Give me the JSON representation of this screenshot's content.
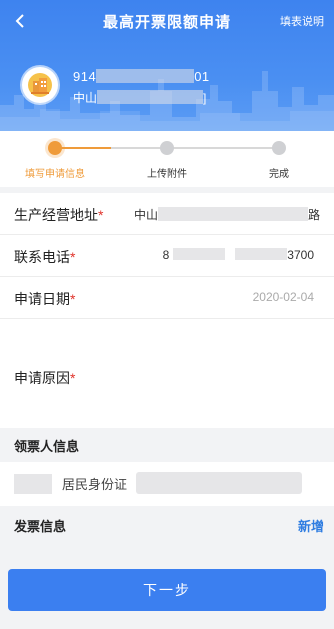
{
  "nav": {
    "back_icon": "chevron-left-icon",
    "title": "最高开票限额申请",
    "help_label": "填表说明"
  },
  "company": {
    "logo_icon": "building-logo-icon",
    "id_prefix": "914",
    "id_suffix": "01",
    "name_prefix": "中山",
    "name_suffix": "]"
  },
  "steps": [
    {
      "label": "填写申请信息",
      "active": true
    },
    {
      "label": "上传附件",
      "active": false
    },
    {
      "label": "完成",
      "active": false
    }
  ],
  "form": {
    "address": {
      "label": "生产经营地址",
      "required": "*",
      "value_prefix": "中山",
      "value_suffix": "路"
    },
    "phone": {
      "label": "联系电话",
      "required": "*",
      "value_prefix": "8",
      "value_suffix": "3700"
    },
    "date": {
      "label": "申请日期",
      "required": "*",
      "value": "2020-02-04"
    },
    "reason": {
      "label": "申请原因",
      "required": "*"
    }
  },
  "receiver_section": {
    "title": "领票人信息"
  },
  "receiver": {
    "id_type": "居民身份证"
  },
  "invoice_section": {
    "title": "发票信息",
    "action": "新增"
  },
  "next_button": {
    "label": "下一步"
  },
  "colors": {
    "header_blue": "#3e83ef",
    "accent_orange": "#ef9b3a",
    "required_red": "#e0322a",
    "link_blue": "#2f7de1",
    "button_blue": "#3b7ff0"
  }
}
